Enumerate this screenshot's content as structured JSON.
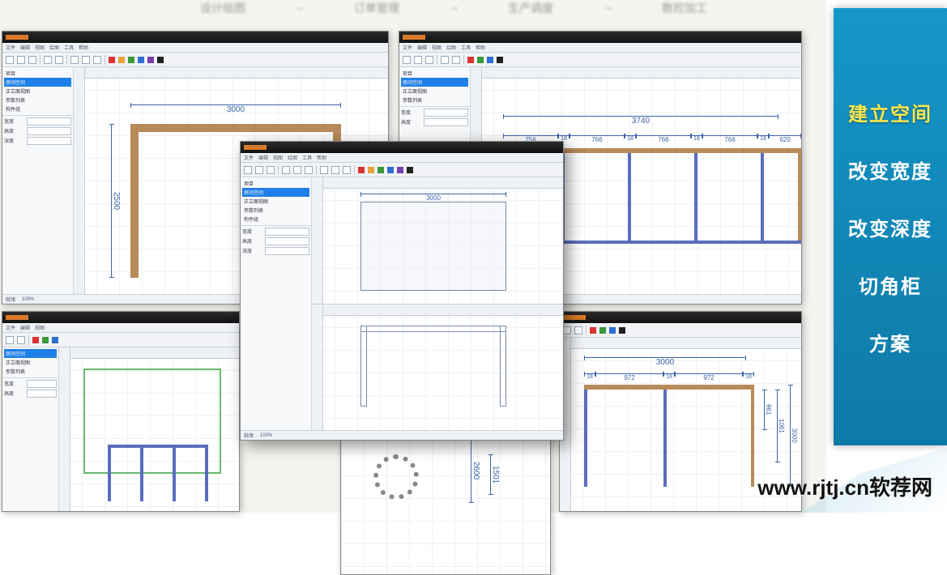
{
  "topblur": [
    "设计绘图",
    "→",
    "订单管理",
    "→",
    "生产调度",
    "→",
    "数控加工"
  ],
  "rightnav": {
    "items": [
      {
        "label": "建立空间",
        "active": true
      },
      {
        "label": "改变宽度",
        "active": false
      },
      {
        "label": "改变深度",
        "active": false
      },
      {
        "label": "切角柜",
        "active": false
      },
      {
        "label": "方案",
        "active": false
      }
    ]
  },
  "watermark": "www.rjtj.cn软荐网",
  "menubar": [
    "文件",
    "编辑",
    "视图",
    "绘图",
    "工具",
    "帮助"
  ],
  "tree_items": [
    "项目",
    "房间空间",
    "正立面视图",
    "参数列表",
    "构件组"
  ],
  "prop_rows": [
    "宽度",
    "高度",
    "深度"
  ],
  "swatches": [
    "#d33",
    "#e8a23a",
    "#3a9a3a",
    "#2d6fd1",
    "#7a3fb0",
    "#222"
  ],
  "status": [
    "就绪",
    "100%"
  ],
  "windows": {
    "tl": {
      "dims": {
        "top_w": "3000",
        "left_h": "2500"
      }
    },
    "tr": {
      "dims": {
        "top_w": "3740",
        "segs": [
          "756",
          "18",
          "766",
          "18",
          "766",
          "18",
          "766",
          "18",
          "620"
        ]
      }
    },
    "center": {
      "dims": {
        "panel_w": "3000"
      }
    },
    "br": {
      "dims": {
        "top_w": "3000",
        "segs": [
          "18",
          "972",
          "18",
          "972",
          "18"
        ],
        "right": [
          "961",
          "1061",
          "3000"
        ]
      }
    },
    "bl": {
      "dims": {}
    },
    "bc": {
      "dims": {
        "v1": "2600",
        "v2": "1501"
      }
    }
  }
}
